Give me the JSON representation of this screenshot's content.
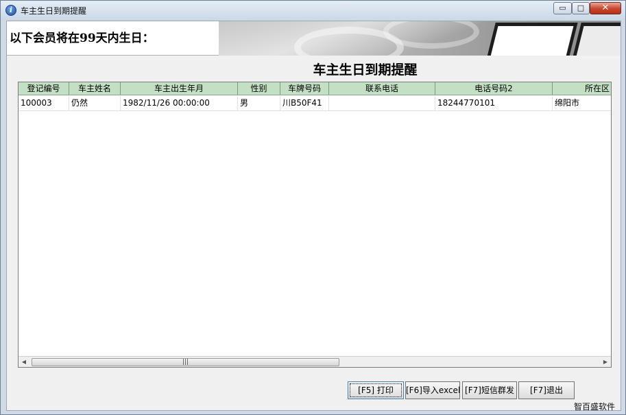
{
  "window": {
    "title": "车主生日到期提醒",
    "icon": "info-icon",
    "controls": {
      "minimize": "▭",
      "maximize": "□",
      "close": "✕"
    }
  },
  "banner": {
    "text": "以下会员将在99天内生日："
  },
  "page_title": "车主生日到期提醒",
  "table": {
    "columns": [
      "登记编号",
      "车主姓名",
      "车主出生年月",
      "性别",
      "车牌号码",
      "联系电话",
      "电话号码2",
      "所在区"
    ],
    "rows": [
      [
        "100003",
        "仍然",
        "1982/11/26 00:00:00",
        "男",
        "川B50F41",
        "",
        "18244770101",
        "绵阳市"
      ]
    ],
    "header_color": "#c4e0c4"
  },
  "scrollbar": {
    "left_arrow": "◀",
    "right_arrow": "▶",
    "grip": "|||"
  },
  "buttons": {
    "print": "[F5] 打印",
    "export_excel": "[F6]导入excel",
    "sms": "[F7]短信群发",
    "exit": "[F7]退出"
  },
  "brand": "智百盛软件"
}
